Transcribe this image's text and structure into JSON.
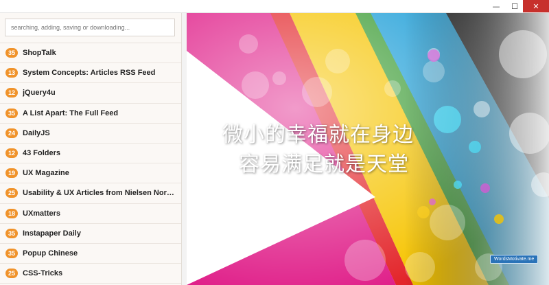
{
  "window": {
    "minimize_glyph": "—",
    "maximize_glyph": "☐",
    "close_glyph": "✕"
  },
  "search": {
    "placeholder": "searching, adding, saving or downloading..."
  },
  "feeds": [
    {
      "count": "35",
      "title": "ShopTalk"
    },
    {
      "count": "13",
      "title": "System Concepts: Articles RSS Feed"
    },
    {
      "count": "12",
      "title": "jQuery4u"
    },
    {
      "count": "35",
      "title": "A List Apart: The Full Feed"
    },
    {
      "count": "24",
      "title": "DailyJS"
    },
    {
      "count": "12",
      "title": "43 Folders"
    },
    {
      "count": "19",
      "title": "UX Magazine"
    },
    {
      "count": "25",
      "title": "Usability & UX Articles from Nielsen Norma..."
    },
    {
      "count": "18",
      "title": "UXmatters"
    },
    {
      "count": "35",
      "title": "Instapaper Daily"
    },
    {
      "count": "35",
      "title": "Popup Chinese"
    },
    {
      "count": "25",
      "title": "CSS-Tricks"
    }
  ],
  "wallpaper": {
    "line1": "微小的幸福就在身边",
    "line2": "容易满足就是天堂",
    "watermark": "WordsMotivate.me"
  },
  "colors": {
    "badge": "#f0932b",
    "close_button": "#c7302c",
    "magenta": "#e0218a",
    "red": "#e3262b",
    "yellow": "#f6c400",
    "green": "#3c9c35",
    "cyan": "#1f9fd8",
    "black": "#1a1a1a"
  }
}
